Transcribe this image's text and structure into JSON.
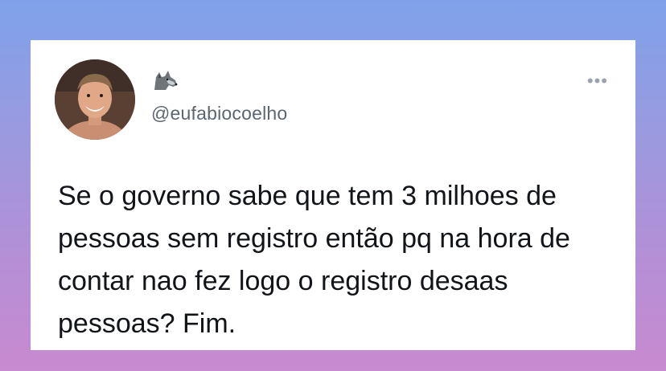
{
  "tweet": {
    "handle": "@eufabiocoelho",
    "name_icon": "wolf-emoji-icon",
    "more_label": "•••",
    "text": "Se o governo sabe que tem 3 milhoes de pessoas sem registro então pq na hora de contar nao fez logo o registro desaas pessoas?  Fim."
  },
  "colors": {
    "background_top": "#7ea2ea",
    "background_bottom": "#c88ad0",
    "card": "#ffffff",
    "handle": "#5b6670",
    "text": "#111418"
  }
}
